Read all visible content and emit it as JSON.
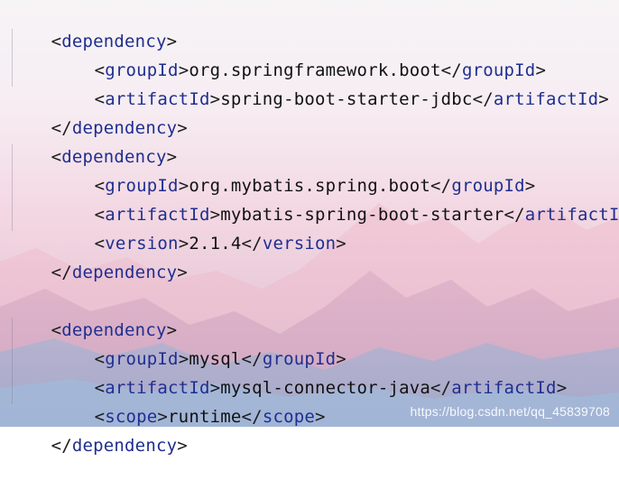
{
  "code_lines": [
    {
      "open": "<",
      "tag": "dependency",
      "close": ">",
      "value": ""
    },
    {
      "open": "<",
      "tag": "groupId",
      "close": ">",
      "value": "org.springframework.boot",
      "end_open": "</",
      "end_tag": "groupId",
      "end_close": ">"
    },
    {
      "open": "<",
      "tag": "artifactId",
      "close": ">",
      "value": "spring-boot-starter-jdbc",
      "end_open": "</",
      "end_tag": "artifactId",
      "end_close": ">"
    },
    {
      "open": "</",
      "tag": "dependency",
      "close": ">",
      "value": ""
    },
    {
      "open": "<",
      "tag": "dependency",
      "close": ">",
      "value": ""
    },
    {
      "open": "<",
      "tag": "groupId",
      "close": ">",
      "value": "org.mybatis.spring.boot",
      "end_open": "</",
      "end_tag": "groupId",
      "end_close": ">"
    },
    {
      "open": "<",
      "tag": "artifactId",
      "close": ">",
      "value": "mybatis-spring-boot-starter",
      "end_open": "</",
      "end_tag": "artifactId",
      "end_close": ">"
    },
    {
      "open": "<",
      "tag": "version",
      "close": ">",
      "value": "2.1.4",
      "end_open": "</",
      "end_tag": "version",
      "end_close": ">"
    },
    {
      "open": "</",
      "tag": "dependency",
      "close": ">",
      "value": ""
    },
    {
      "open": "<",
      "tag": "dependency",
      "close": ">",
      "value": ""
    },
    {
      "open": "<",
      "tag": "groupId",
      "close": ">",
      "value": "mysql",
      "end_open": "</",
      "end_tag": "groupId",
      "end_close": ">"
    },
    {
      "open": "<",
      "tag": "artifactId",
      "close": ">",
      "value": "mysql-connector-java",
      "end_open": "</",
      "end_tag": "artifactId",
      "end_close": ">"
    },
    {
      "open": "<",
      "tag": "scope",
      "close": ">",
      "value": "runtime",
      "end_open": "</",
      "end_tag": "scope",
      "end_close": ">"
    },
    {
      "open": "</",
      "tag": "dependency",
      "close": ">",
      "value": ""
    }
  ],
  "watermark": "https://blog.csdn.net/qq_45839708",
  "colors": {
    "tag": "#1f2e8f",
    "punct": "#1c1c1c",
    "value": "#111111"
  }
}
